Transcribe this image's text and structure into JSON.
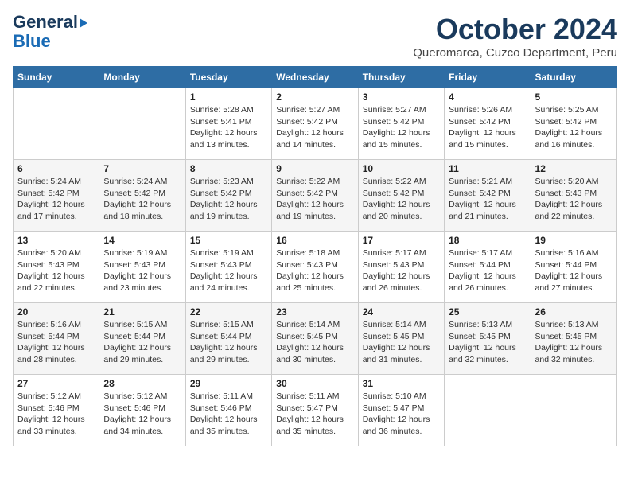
{
  "logo": {
    "line1": "General",
    "line2": "Blue"
  },
  "title": "October 2024",
  "subtitle": "Queromarca, Cuzco Department, Peru",
  "days_header": [
    "Sunday",
    "Monday",
    "Tuesday",
    "Wednesday",
    "Thursday",
    "Friday",
    "Saturday"
  ],
  "weeks": [
    [
      {
        "num": "",
        "info": ""
      },
      {
        "num": "",
        "info": ""
      },
      {
        "num": "1",
        "info": "Sunrise: 5:28 AM\nSunset: 5:41 PM\nDaylight: 12 hours and 13 minutes."
      },
      {
        "num": "2",
        "info": "Sunrise: 5:27 AM\nSunset: 5:42 PM\nDaylight: 12 hours and 14 minutes."
      },
      {
        "num": "3",
        "info": "Sunrise: 5:27 AM\nSunset: 5:42 PM\nDaylight: 12 hours and 15 minutes."
      },
      {
        "num": "4",
        "info": "Sunrise: 5:26 AM\nSunset: 5:42 PM\nDaylight: 12 hours and 15 minutes."
      },
      {
        "num": "5",
        "info": "Sunrise: 5:25 AM\nSunset: 5:42 PM\nDaylight: 12 hours and 16 minutes."
      }
    ],
    [
      {
        "num": "6",
        "info": "Sunrise: 5:24 AM\nSunset: 5:42 PM\nDaylight: 12 hours and 17 minutes."
      },
      {
        "num": "7",
        "info": "Sunrise: 5:24 AM\nSunset: 5:42 PM\nDaylight: 12 hours and 18 minutes."
      },
      {
        "num": "8",
        "info": "Sunrise: 5:23 AM\nSunset: 5:42 PM\nDaylight: 12 hours and 19 minutes."
      },
      {
        "num": "9",
        "info": "Sunrise: 5:22 AM\nSunset: 5:42 PM\nDaylight: 12 hours and 19 minutes."
      },
      {
        "num": "10",
        "info": "Sunrise: 5:22 AM\nSunset: 5:42 PM\nDaylight: 12 hours and 20 minutes."
      },
      {
        "num": "11",
        "info": "Sunrise: 5:21 AM\nSunset: 5:42 PM\nDaylight: 12 hours and 21 minutes."
      },
      {
        "num": "12",
        "info": "Sunrise: 5:20 AM\nSunset: 5:43 PM\nDaylight: 12 hours and 22 minutes."
      }
    ],
    [
      {
        "num": "13",
        "info": "Sunrise: 5:20 AM\nSunset: 5:43 PM\nDaylight: 12 hours and 22 minutes."
      },
      {
        "num": "14",
        "info": "Sunrise: 5:19 AM\nSunset: 5:43 PM\nDaylight: 12 hours and 23 minutes."
      },
      {
        "num": "15",
        "info": "Sunrise: 5:19 AM\nSunset: 5:43 PM\nDaylight: 12 hours and 24 minutes."
      },
      {
        "num": "16",
        "info": "Sunrise: 5:18 AM\nSunset: 5:43 PM\nDaylight: 12 hours and 25 minutes."
      },
      {
        "num": "17",
        "info": "Sunrise: 5:17 AM\nSunset: 5:43 PM\nDaylight: 12 hours and 26 minutes."
      },
      {
        "num": "18",
        "info": "Sunrise: 5:17 AM\nSunset: 5:44 PM\nDaylight: 12 hours and 26 minutes."
      },
      {
        "num": "19",
        "info": "Sunrise: 5:16 AM\nSunset: 5:44 PM\nDaylight: 12 hours and 27 minutes."
      }
    ],
    [
      {
        "num": "20",
        "info": "Sunrise: 5:16 AM\nSunset: 5:44 PM\nDaylight: 12 hours and 28 minutes."
      },
      {
        "num": "21",
        "info": "Sunrise: 5:15 AM\nSunset: 5:44 PM\nDaylight: 12 hours and 29 minutes."
      },
      {
        "num": "22",
        "info": "Sunrise: 5:15 AM\nSunset: 5:44 PM\nDaylight: 12 hours and 29 minutes."
      },
      {
        "num": "23",
        "info": "Sunrise: 5:14 AM\nSunset: 5:45 PM\nDaylight: 12 hours and 30 minutes."
      },
      {
        "num": "24",
        "info": "Sunrise: 5:14 AM\nSunset: 5:45 PM\nDaylight: 12 hours and 31 minutes."
      },
      {
        "num": "25",
        "info": "Sunrise: 5:13 AM\nSunset: 5:45 PM\nDaylight: 12 hours and 32 minutes."
      },
      {
        "num": "26",
        "info": "Sunrise: 5:13 AM\nSunset: 5:45 PM\nDaylight: 12 hours and 32 minutes."
      }
    ],
    [
      {
        "num": "27",
        "info": "Sunrise: 5:12 AM\nSunset: 5:46 PM\nDaylight: 12 hours and 33 minutes."
      },
      {
        "num": "28",
        "info": "Sunrise: 5:12 AM\nSunset: 5:46 PM\nDaylight: 12 hours and 34 minutes."
      },
      {
        "num": "29",
        "info": "Sunrise: 5:11 AM\nSunset: 5:46 PM\nDaylight: 12 hours and 35 minutes."
      },
      {
        "num": "30",
        "info": "Sunrise: 5:11 AM\nSunset: 5:47 PM\nDaylight: 12 hours and 35 minutes."
      },
      {
        "num": "31",
        "info": "Sunrise: 5:10 AM\nSunset: 5:47 PM\nDaylight: 12 hours and 36 minutes."
      },
      {
        "num": "",
        "info": ""
      },
      {
        "num": "",
        "info": ""
      }
    ]
  ]
}
